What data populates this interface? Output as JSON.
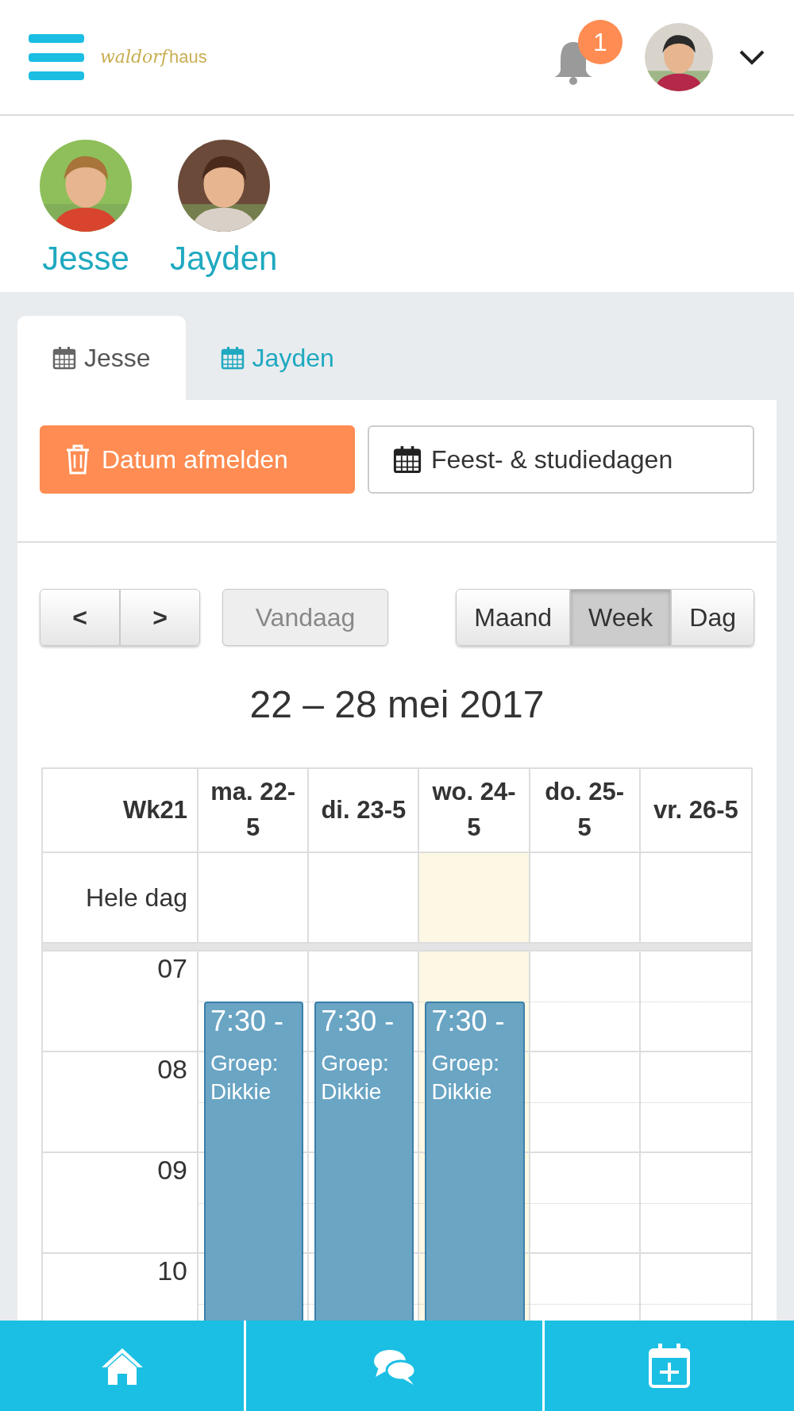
{
  "header": {
    "logo": {
      "script": "waldorf",
      "plain": "haus"
    },
    "notifications": {
      "count": "1"
    }
  },
  "children": [
    {
      "name": "Jesse"
    },
    {
      "name": "Jayden"
    }
  ],
  "tabs": [
    {
      "label": "Jesse",
      "selected": true
    },
    {
      "label": "Jayden",
      "selected": false
    }
  ],
  "actions": [
    {
      "label": "Datum afmelden",
      "kind": "primary"
    },
    {
      "label": "Feest- & studiedagen",
      "kind": "outline"
    }
  ],
  "toolbar": {
    "prev": "<",
    "next": ">",
    "today": {
      "label": "Vandaag",
      "disabled": true
    },
    "views": [
      {
        "label": "Maand",
        "selected": false
      },
      {
        "label": "Week",
        "selected": true
      },
      {
        "label": "Dag",
        "selected": false
      }
    ]
  },
  "range_title": "22 – 28 mei 2017",
  "calendar": {
    "week_label": "Wk21",
    "allday_label": "Hele dag",
    "hours": [
      "07",
      "08",
      "09",
      "10"
    ],
    "days": [
      {
        "label": "ma. 22-5",
        "today": false,
        "events": [
          {
            "time": "7:30 -",
            "title": "Groep: Dikkie"
          }
        ]
      },
      {
        "label": "di. 23-5",
        "today": false,
        "events": [
          {
            "time": "7:30 -",
            "title": "Groep: Dikkie"
          }
        ]
      },
      {
        "label": "wo. 24-5",
        "today": true,
        "events": [
          {
            "time": "7:30 -",
            "title": "Groep: Dikkie"
          }
        ]
      },
      {
        "label": "do. 25-5",
        "today": false
      },
      {
        "label": "vr. 26-5",
        "today": false
      }
    ]
  }
}
